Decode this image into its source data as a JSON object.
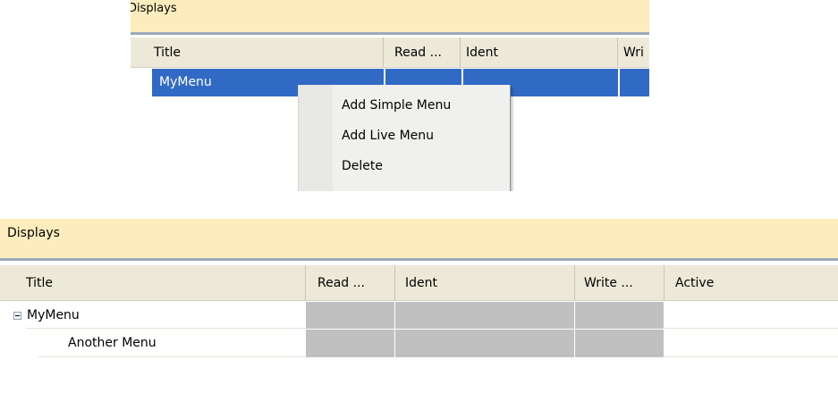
{
  "top_view": {
    "section_title": "Displays",
    "columns": [
      "Title",
      "Read ...",
      "Ident",
      "Wri"
    ],
    "selected_row": {
      "title": "MyMenu"
    },
    "context_menu": {
      "items": [
        "Add Simple Menu",
        "Add Live Menu",
        "Delete"
      ]
    }
  },
  "bottom_view": {
    "section_title": "Displays",
    "columns": [
      "Title",
      "Read ...",
      "Ident",
      "Write ...",
      "Active"
    ],
    "rows": [
      {
        "title": "MyMenu",
        "expanded": true
      },
      {
        "title": "Another Menu"
      }
    ]
  }
}
